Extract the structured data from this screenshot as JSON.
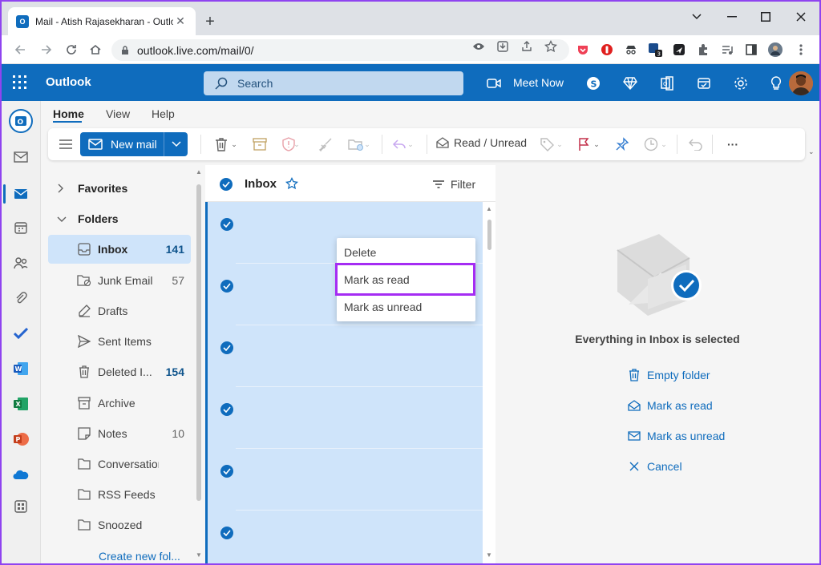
{
  "browser": {
    "tab_title": "Mail - Atish Rajasekharan - Outlo",
    "url": "outlook.live.com/mail/0/"
  },
  "header": {
    "app_name": "Outlook",
    "search_placeholder": "Search",
    "meet_now": "Meet Now"
  },
  "ribbon": {
    "tabs": [
      "Home",
      "View",
      "Help"
    ],
    "new_mail": "New mail",
    "read_unread": "Read / Unread",
    "more": "···"
  },
  "folders": {
    "favorites_label": "Favorites",
    "folders_label": "Folders",
    "items": [
      {
        "label": "Inbox",
        "count": "141",
        "icon": "inbox-icon"
      },
      {
        "label": "Junk Email",
        "count": "57",
        "icon": "junk-icon"
      },
      {
        "label": "Drafts",
        "count": "",
        "icon": "drafts-icon"
      },
      {
        "label": "Sent Items",
        "count": "",
        "icon": "sent-icon"
      },
      {
        "label": "Deleted I...",
        "count": "154",
        "icon": "trash-icon"
      },
      {
        "label": "Archive",
        "count": "",
        "icon": "archive-icon"
      },
      {
        "label": "Notes",
        "count": "10",
        "icon": "notes-icon"
      },
      {
        "label": "Conversation ...",
        "count": "",
        "icon": "folder-icon"
      },
      {
        "label": "RSS Feeds",
        "count": "",
        "icon": "folder-icon"
      },
      {
        "label": "Snoozed",
        "count": "",
        "icon": "folder-icon"
      }
    ],
    "create_new": "Create new fol..."
  },
  "message_list": {
    "title": "Inbox",
    "filter": "Filter"
  },
  "context_menu": {
    "items": [
      "Delete",
      "Mark as read",
      "Mark as unread"
    ]
  },
  "reading_pane": {
    "selected_text": "Everything in Inbox is selected",
    "actions": [
      "Empty folder",
      "Mark as read",
      "Mark as unread",
      "Cancel"
    ]
  },
  "colors": {
    "brand": "#0f6cbd",
    "selection": "#cfe4fa",
    "highlight_border": "#a52cf3"
  }
}
